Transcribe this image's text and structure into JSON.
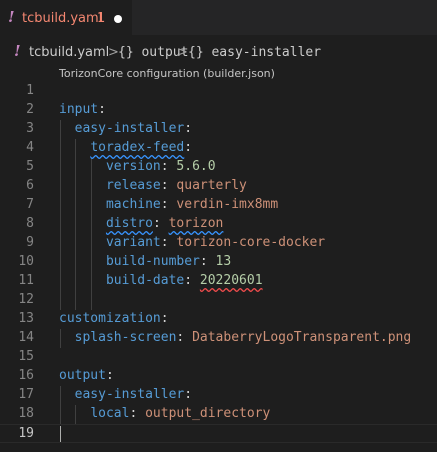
{
  "tab": {
    "icon": "yaml-icon",
    "label": "tcbuild.yaml",
    "problems": "1",
    "dirty": "modified-dot"
  },
  "breadcrumb": {
    "file": "tcbuild.yaml",
    "items": [
      "{} output",
      "{} easy-installer"
    ],
    "separator": ">"
  },
  "schema_hint": "TorizonCore configuration (builder.json)",
  "colors": {
    "key": "#569cd6",
    "string": "#ce9178",
    "number": "#b5cea8",
    "error_tab": "#f48771",
    "yaml_icon": "#c586c0"
  },
  "lines": [
    {
      "no": "1"
    },
    {
      "no": "2",
      "key": "input"
    },
    {
      "no": "3",
      "key": "easy-installer"
    },
    {
      "no": "4",
      "key": "toradex-feed"
    },
    {
      "no": "5",
      "key": "version",
      "value": "5.6.0"
    },
    {
      "no": "6",
      "key": "release",
      "value": "quarterly"
    },
    {
      "no": "7",
      "key": "machine",
      "value": "verdin-imx8mm"
    },
    {
      "no": "8",
      "key": "distro",
      "value": "torizon"
    },
    {
      "no": "9",
      "key": "variant",
      "value": "torizon-core-docker"
    },
    {
      "no": "10",
      "key": "build-number",
      "value": "13"
    },
    {
      "no": "11",
      "key": "build-date",
      "value": "20220601"
    },
    {
      "no": "12"
    },
    {
      "no": "13",
      "key": "customization"
    },
    {
      "no": "14",
      "key": "splash-screen",
      "value": "DataberryLogoTransparent.png"
    },
    {
      "no": "15"
    },
    {
      "no": "16",
      "key": "output"
    },
    {
      "no": "17",
      "key": "easy-installer"
    },
    {
      "no": "18",
      "key": "local",
      "value": "output_directory"
    },
    {
      "no": "19"
    }
  ]
}
